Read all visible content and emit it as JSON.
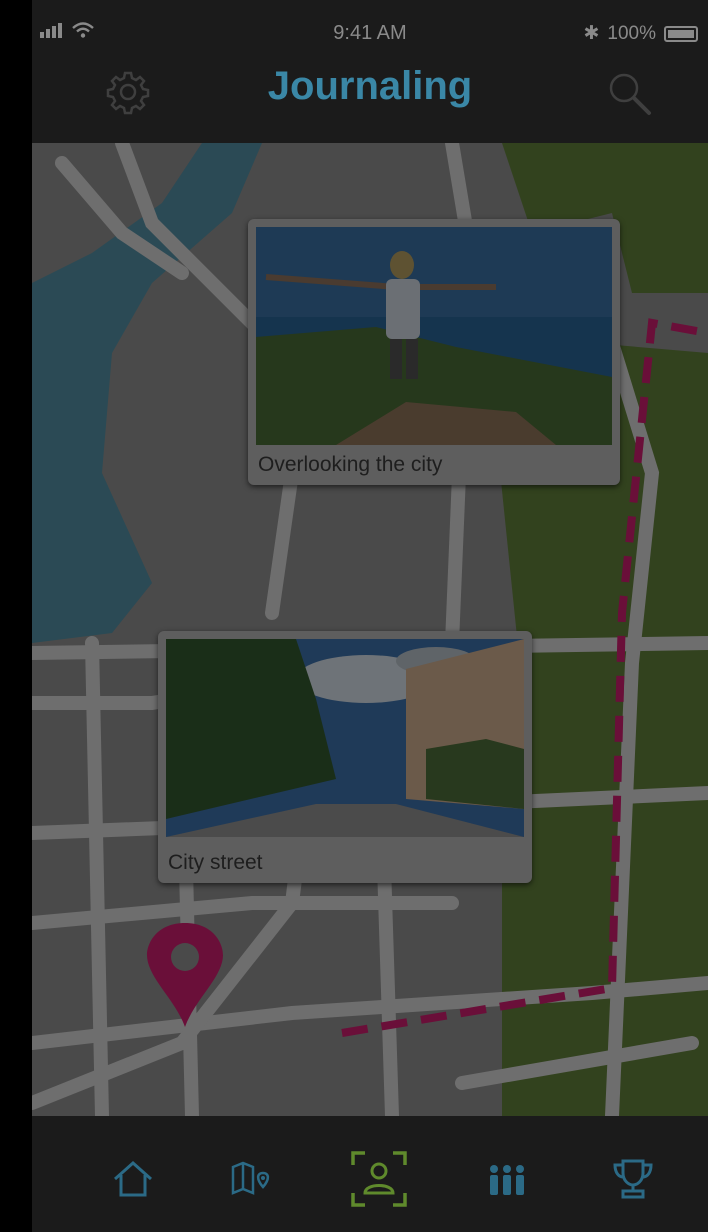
{
  "status_bar": {
    "time": "9:41 AM",
    "battery": "100%"
  },
  "header": {
    "title": "Journaling"
  },
  "cards": [
    {
      "caption": "Overlooking the city"
    },
    {
      "caption": "City street"
    }
  ],
  "tabs": [
    {
      "icon": "home-icon"
    },
    {
      "icon": "map-icon"
    },
    {
      "icon": "journal-icon",
      "active": true
    },
    {
      "icon": "group-icon"
    },
    {
      "icon": "trophy-icon"
    }
  ],
  "colors": {
    "accent": "#3a87a6",
    "route": "#b0125a",
    "active_tab": "#5f8a2c"
  }
}
